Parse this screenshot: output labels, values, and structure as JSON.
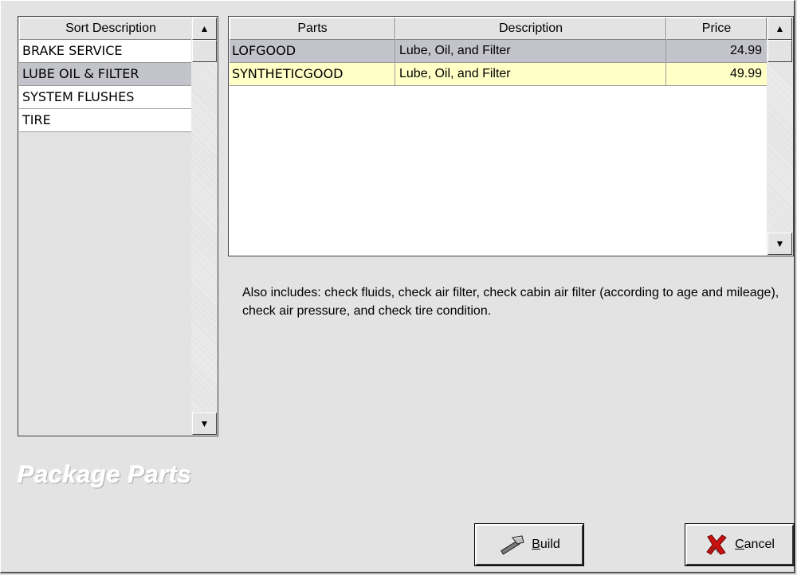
{
  "sort_list": {
    "header": "Sort Description",
    "items": [
      {
        "label": "BRAKE SERVICE",
        "selected": false
      },
      {
        "label": "LUBE OIL & FILTER",
        "selected": true
      },
      {
        "label": "SYSTEM FLUSHES",
        "selected": false
      },
      {
        "label": "TIRE",
        "selected": false
      }
    ]
  },
  "parts_grid": {
    "columns": {
      "parts": "Parts",
      "description": "Description",
      "price": "Price"
    },
    "rows": [
      {
        "parts": "LOFGOOD",
        "description": "Lube, Oil, and Filter",
        "price": "24.99",
        "state": "selected"
      },
      {
        "parts": "SYNTHETICGOOD",
        "description": "Lube, Oil, and Filter",
        "price": "49.99",
        "state": "highlight"
      }
    ]
  },
  "includes_text": "Also includes: check fluids, check air filter, check cabin air filter (according to age and mileage), check air pressure, and check tire condition.",
  "watermark": "Package Parts",
  "buttons": {
    "build": {
      "accel": "B",
      "rest": "uild",
      "icon": "hammer-icon"
    },
    "cancel": {
      "accel": "C",
      "rest": "ancel",
      "icon": "red-x-icon"
    }
  },
  "colors": {
    "background": "#e3e3e3",
    "selected_row": "#c3c3cc",
    "highlight_row": "#ffffc6",
    "cancel_x": "#cc1111"
  }
}
